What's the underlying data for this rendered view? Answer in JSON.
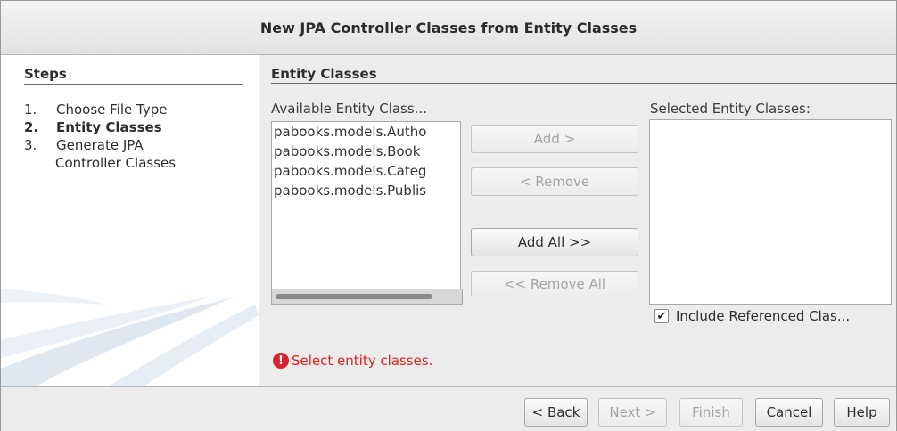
{
  "window": {
    "title": "New JPA Controller Classes from Entity Classes"
  },
  "steps": {
    "title": "Steps",
    "items": [
      {
        "num": "1.",
        "label": "Choose File Type"
      },
      {
        "num": "2.",
        "label": "Entity Classes"
      },
      {
        "num": "3.",
        "label": "Generate JPA",
        "label2": "Controller Classes"
      }
    ]
  },
  "content": {
    "title": "Entity Classes",
    "available_label": "Available Entity Class...",
    "available_items": [
      "pabooks.models.Autho",
      "pabooks.models.Book",
      "pabooks.models.Categ",
      "pabooks.models.Publis"
    ],
    "selected_label": "Selected Entity Classes:",
    "add_label": "Add >",
    "remove_label": "< Remove",
    "add_all_label": "Add All >>",
    "remove_all_label": "<< Remove All",
    "include_label": "Include Referenced Clas...",
    "include_checked": true,
    "error_message": "Select entity classes."
  },
  "footer": {
    "back_label": "< Back",
    "next_label": "Next >",
    "finish_label": "Finish",
    "cancel_label": "Cancel",
    "help_label": "Help"
  }
}
